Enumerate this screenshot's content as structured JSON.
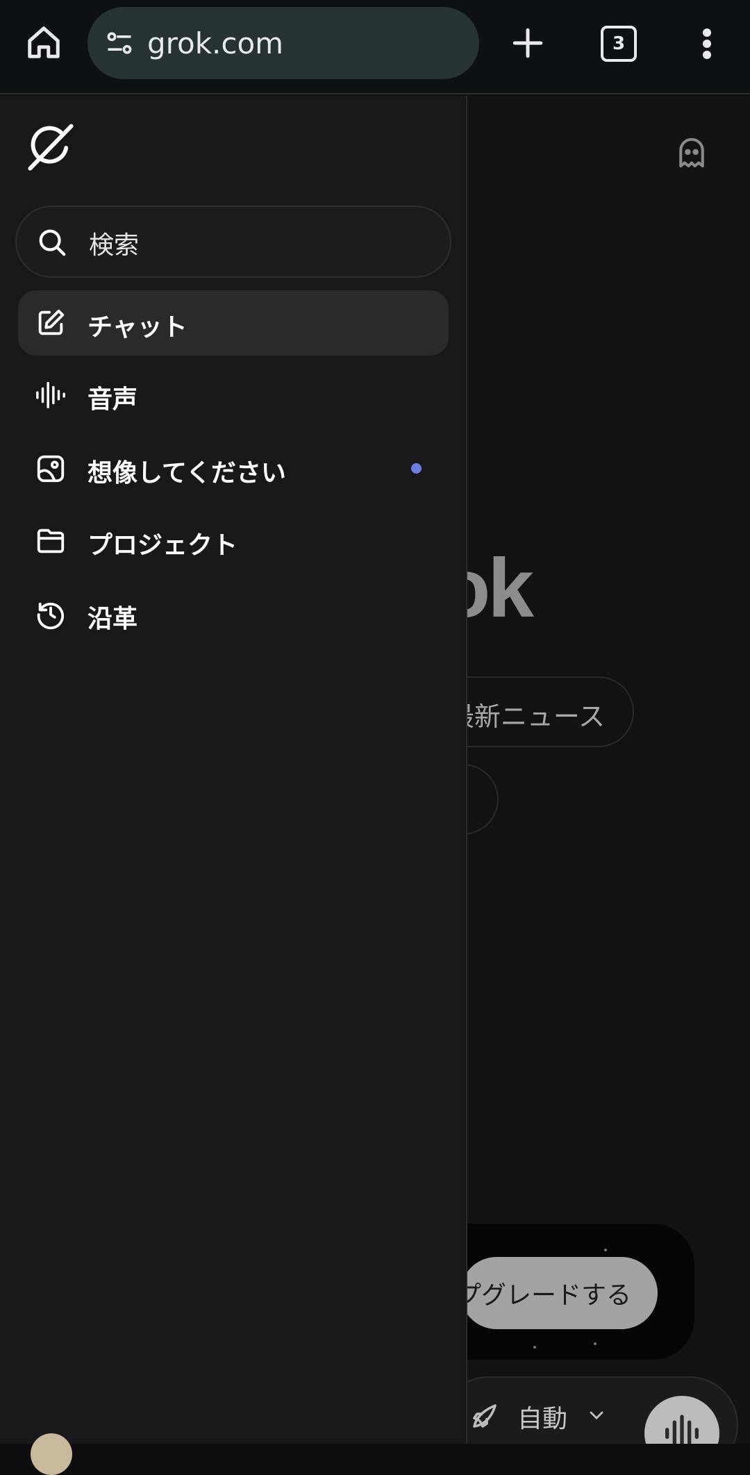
{
  "browser": {
    "url": "grok.com",
    "tab_count": "3"
  },
  "drawer": {
    "search_label": "検索",
    "items": [
      {
        "label": "チャット",
        "icon": "edit-icon"
      },
      {
        "label": "音声",
        "icon": "waveform-icon"
      },
      {
        "label": "想像してください",
        "icon": "image-icon"
      },
      {
        "label": "プロジェクト",
        "icon": "folder-icon"
      },
      {
        "label": "沿革",
        "icon": "history-icon"
      }
    ]
  },
  "background": {
    "brand_fragment": "ok",
    "chip_news": "最新ニュース",
    "upgrade_fragment": "プグレードする",
    "mode_label": "自動"
  },
  "colors": {
    "drawer_bg": "#18181a",
    "active_item_bg": "#2a2a2d",
    "notification_dot": "#6b7fe0",
    "browser_bar_bg": "#0d1114",
    "url_pill_bg": "#263233"
  }
}
